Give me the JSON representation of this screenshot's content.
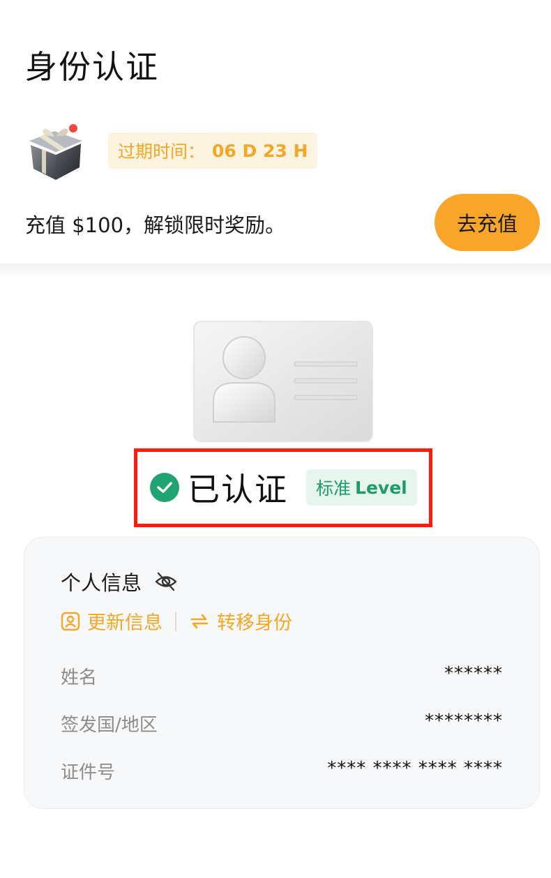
{
  "page": {
    "title": "身份认证"
  },
  "promo": {
    "expiry_label": "过期时间：",
    "expiry_value": "06 D 23 H",
    "description": "充值 $100，解锁限时奖励。",
    "recharge_button": "去充值",
    "gift_icon": "gift-icon"
  },
  "verification": {
    "status": "已认证",
    "level_prefix": "标准",
    "level_value": "Level",
    "status_color": "#20a474"
  },
  "personal_info": {
    "title": "个人信息",
    "update_label": "更新信息",
    "transfer_label": "转移身份",
    "rows": [
      {
        "label": "姓名",
        "value": "******"
      },
      {
        "label": "签发国/地区",
        "value": "********"
      },
      {
        "label": "证件号",
        "value": "**** **** **** ****"
      }
    ]
  },
  "colors": {
    "accent": "#f9a529",
    "verified": "#20a474",
    "highlight": "#ff1a0a"
  }
}
